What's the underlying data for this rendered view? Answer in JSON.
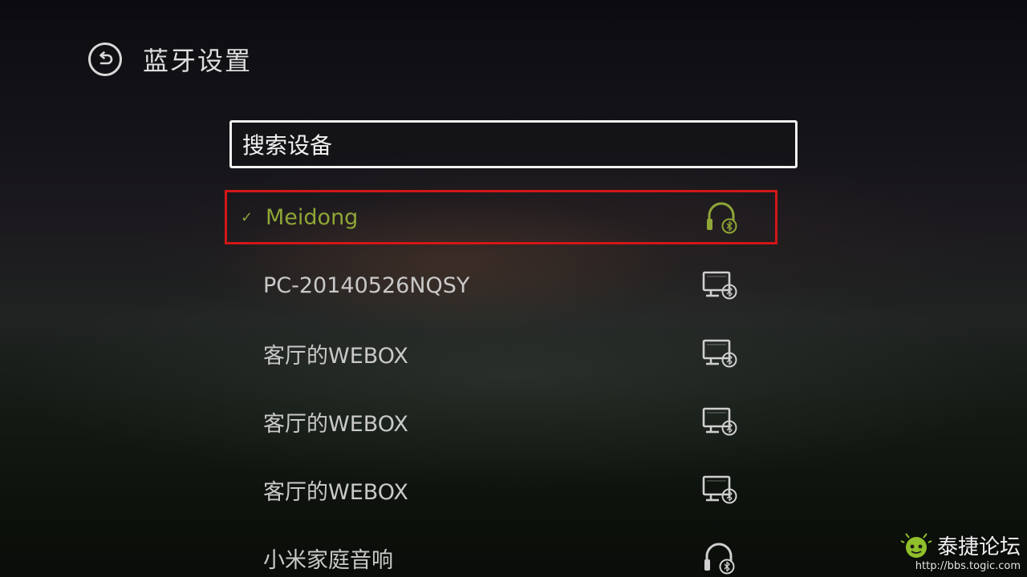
{
  "header": {
    "back_icon": "back-arrow-icon",
    "title": "蓝牙设置"
  },
  "search": {
    "label": "搜索设备"
  },
  "devices": [
    {
      "name": "Meidong",
      "icon": "headphones-bluetooth-icon",
      "connected": true,
      "selected": true
    },
    {
      "name": "PC-20140526NQSY",
      "icon": "computer-bluetooth-icon",
      "connected": false,
      "selected": false
    },
    {
      "name": "客厅的WEBOX",
      "icon": "computer-bluetooth-icon",
      "connected": false,
      "selected": false
    },
    {
      "name": "客厅的WEBOX",
      "icon": "computer-bluetooth-icon",
      "connected": false,
      "selected": false
    },
    {
      "name": "客厅的WEBOX",
      "icon": "computer-bluetooth-icon",
      "connected": false,
      "selected": false
    },
    {
      "name": "小米家庭音响",
      "icon": "headphones-bluetooth-icon",
      "connected": false,
      "selected": false
    }
  ],
  "connected_mark": "✓",
  "colors": {
    "accent": "#8fa636",
    "selection_border": "#d21717",
    "text": "#c9c9c9"
  },
  "watermark": {
    "title": "泰捷论坛",
    "url": "http://bbs.togic.com"
  }
}
